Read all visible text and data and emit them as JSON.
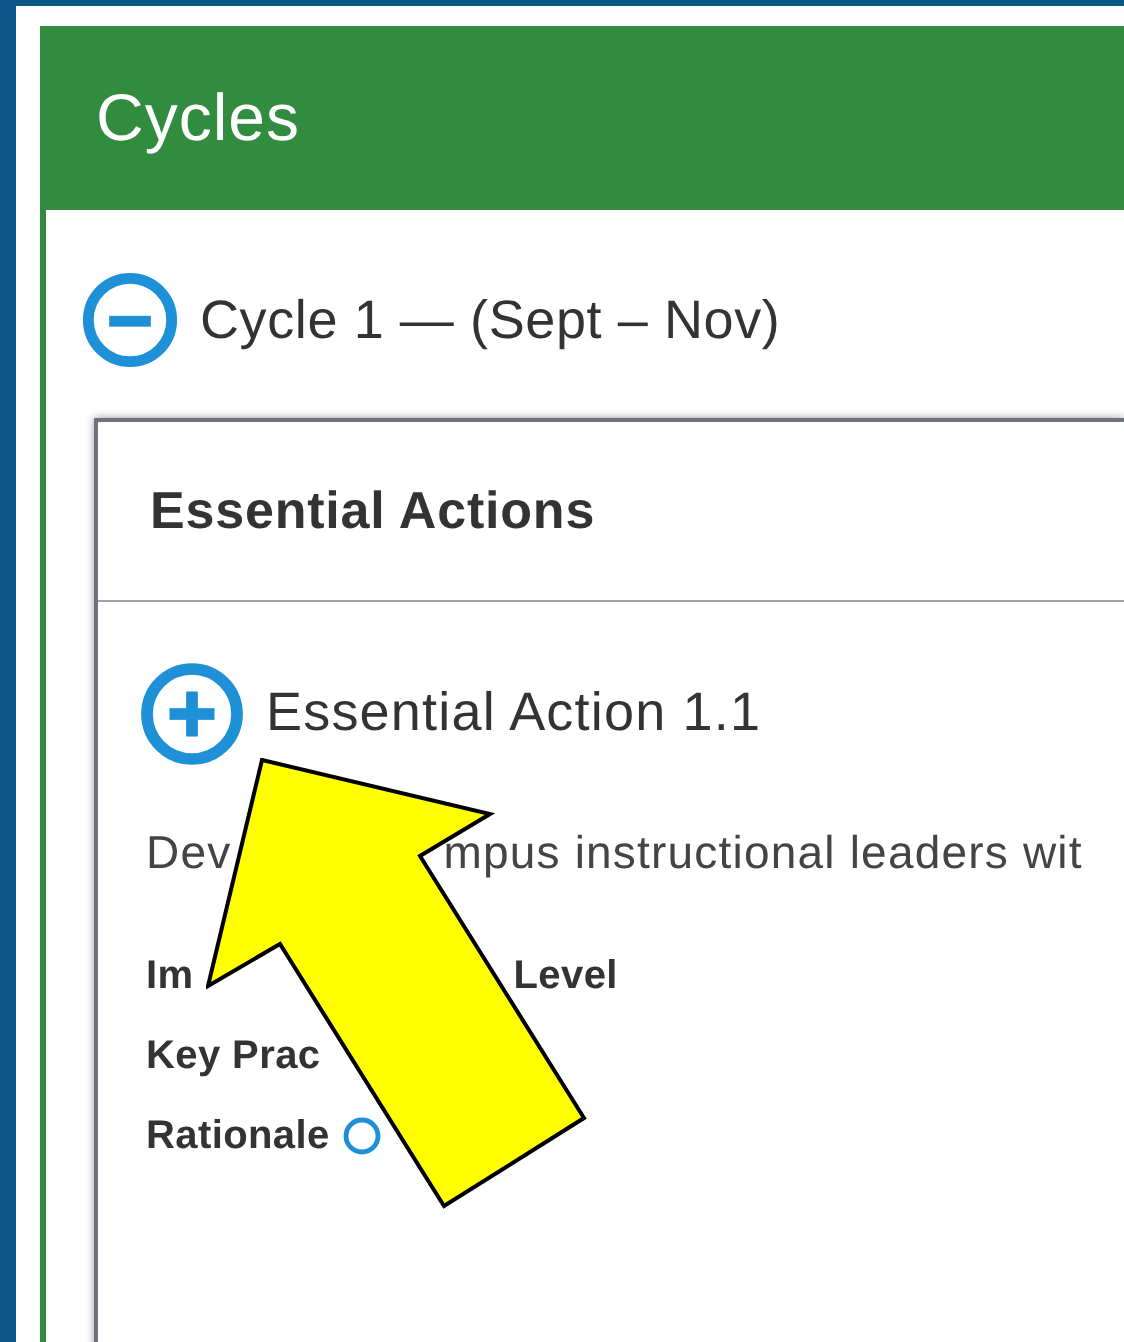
{
  "panel": {
    "title": "Cycles"
  },
  "cycles": [
    {
      "label": "Cycle 1 — (Sept – Nov)",
      "expanded": true,
      "essential_actions": {
        "title": "Essential Actions",
        "actions": [
          {
            "label": "Essential Action 1.1",
            "expanded": false,
            "description": [
              "Dev",
              "mpus instructional leaders wit"
            ],
            "fields": [
              {
                "label": [
                  "Im",
                  "Level"
                ],
                "info": false
              },
              {
                "label": [
                  "Key Prac"
                ],
                "info": false
              },
              {
                "label": [
                  "Rationale"
                ],
                "info": true
              }
            ]
          }
        ]
      }
    }
  ]
}
